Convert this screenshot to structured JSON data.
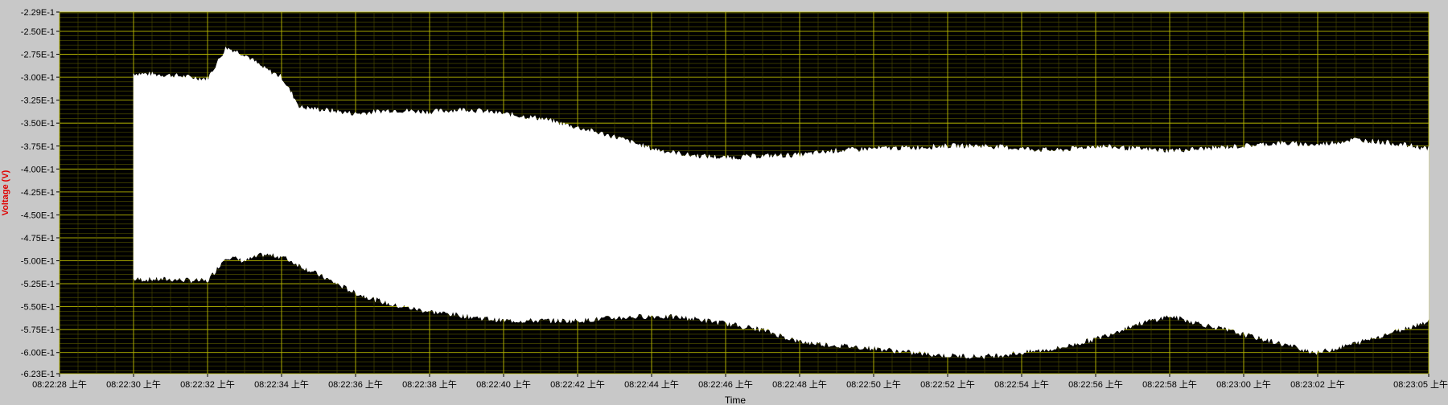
{
  "chart_data": {
    "type": "area",
    "title": "",
    "xlabel": "Time",
    "ylabel": "Voltage (V)",
    "xlim": [
      "08:22:28",
      "08:23:05"
    ],
    "ylim": [
      -0.623,
      -0.229
    ],
    "grid": true,
    "colors": {
      "plot_bg": "#000000",
      "grid": "#c8c800",
      "fill": "#ffffff",
      "ylabel": "#e00000",
      "frame": "#c8c8c8"
    },
    "y_ticks": [
      {
        "v": -0.229,
        "label": "-2.29E-1"
      },
      {
        "v": -0.25,
        "label": "-2.50E-1"
      },
      {
        "v": -0.275,
        "label": "-2.75E-1"
      },
      {
        "v": -0.3,
        "label": "-3.00E-1"
      },
      {
        "v": -0.325,
        "label": "-3.25E-1"
      },
      {
        "v": -0.35,
        "label": "-3.50E-1"
      },
      {
        "v": -0.375,
        "label": "-3.75E-1"
      },
      {
        "v": -0.4,
        "label": "-4.00E-1"
      },
      {
        "v": -0.425,
        "label": "-4.25E-1"
      },
      {
        "v": -0.45,
        "label": "-4.50E-1"
      },
      {
        "v": -0.475,
        "label": "-4.75E-1"
      },
      {
        "v": -0.5,
        "label": "-5.00E-1"
      },
      {
        "v": -0.525,
        "label": "-5.25E-1"
      },
      {
        "v": -0.55,
        "label": "-5.50E-1"
      },
      {
        "v": -0.575,
        "label": "-5.75E-1"
      },
      {
        "v": -0.6,
        "label": "-6.00E-1"
      },
      {
        "v": -0.623,
        "label": "-6.23E-1"
      }
    ],
    "x_ticks": [
      {
        "t": "08:22:28",
        "label": "08:22:28 上午"
      },
      {
        "t": "08:22:30",
        "label": "08:22:30 上午"
      },
      {
        "t": "08:22:32",
        "label": "08:22:32 上午"
      },
      {
        "t": "08:22:34",
        "label": "08:22:34 上午"
      },
      {
        "t": "08:22:36",
        "label": "08:22:36 上午"
      },
      {
        "t": "08:22:38",
        "label": "08:22:38 上午"
      },
      {
        "t": "08:22:40",
        "label": "08:22:40 上午"
      },
      {
        "t": "08:22:42",
        "label": "08:22:42 上午"
      },
      {
        "t": "08:22:44",
        "label": "08:22:44 上午"
      },
      {
        "t": "08:22:46",
        "label": "08:22:46 上午"
      },
      {
        "t": "08:22:48",
        "label": "08:22:48 上午"
      },
      {
        "t": "08:22:50",
        "label": "08:22:50 上午"
      },
      {
        "t": "08:22:52",
        "label": "08:22:52 上午"
      },
      {
        "t": "08:22:54",
        "label": "08:22:54 上午"
      },
      {
        "t": "08:22:56",
        "label": "08:22:56 上午"
      },
      {
        "t": "08:22:58",
        "label": "08:22:58 上午"
      },
      {
        "t": "08:23:00",
        "label": "08:23:00 上午"
      },
      {
        "t": "08:23:02",
        "label": "08:23:02 上午"
      },
      {
        "t": "08:23:05",
        "label": "08:23:05 上午"
      }
    ],
    "series": [
      {
        "x": [
          "08:22:30",
          "08:22:31",
          "08:22:32",
          "08:22:32.5",
          "08:22:33",
          "08:22:33.5",
          "08:22:34",
          "08:22:34.5",
          "08:22:35",
          "08:22:36",
          "08:22:37",
          "08:22:38",
          "08:22:39",
          "08:22:40",
          "08:22:41",
          "08:22:42",
          "08:22:43",
          "08:22:44",
          "08:22:45",
          "08:22:46",
          "08:22:47",
          "08:22:48",
          "08:22:49",
          "08:22:50",
          "08:22:51",
          "08:22:52",
          "08:22:53",
          "08:22:54",
          "08:22:55",
          "08:22:56",
          "08:22:57",
          "08:22:58",
          "08:22:59",
          "08:23:00",
          "08:23:01",
          "08:23:02",
          "08:23:03",
          "08:23:04",
          "08:23:05"
        ],
        "upper": [
          -0.296,
          -0.298,
          -0.302,
          -0.268,
          -0.275,
          -0.29,
          -0.3,
          -0.333,
          -0.335,
          -0.34,
          -0.336,
          -0.338,
          -0.335,
          -0.34,
          -0.345,
          -0.355,
          -0.365,
          -0.378,
          -0.385,
          -0.388,
          -0.386,
          -0.385,
          -0.38,
          -0.378,
          -0.377,
          -0.375,
          -0.375,
          -0.378,
          -0.38,
          -0.375,
          -0.378,
          -0.38,
          -0.378,
          -0.375,
          -0.372,
          -0.374,
          -0.368,
          -0.372,
          -0.378
        ],
        "lower": [
          -0.52,
          -0.52,
          -0.522,
          -0.495,
          -0.5,
          -0.493,
          -0.495,
          -0.505,
          -0.515,
          -0.535,
          -0.548,
          -0.555,
          -0.56,
          -0.565,
          -0.565,
          -0.565,
          -0.562,
          -0.56,
          -0.562,
          -0.568,
          -0.575,
          -0.588,
          -0.592,
          -0.595,
          -0.6,
          -0.603,
          -0.604,
          -0.6,
          -0.595,
          -0.585,
          -0.57,
          -0.56,
          -0.57,
          -0.58,
          -0.59,
          -0.6,
          -0.59,
          -0.578,
          -0.565
        ]
      }
    ]
  }
}
